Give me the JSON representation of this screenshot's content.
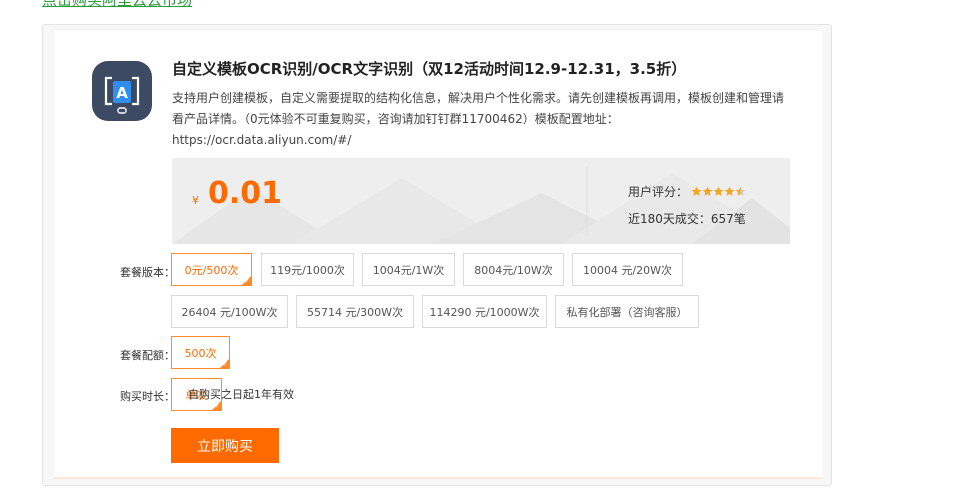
{
  "top_link": "点击购买阿里云云市场",
  "product": {
    "title": "自定义模板OCR识别/OCR文字识别（双12活动时间12.9-12.31，3.5折）",
    "description": "支持用户创建模板，自定义需要提取的结构化信息，解决用户个性化需求。请先创建模板再调用，模板创建和管理请看产品详情。（0元体验不可重复购买，咨询请加钉钉群11700462）模板配置地址：https://ocr.data.aliyun.com/#/",
    "logo_icon": "ocr-scan-logo"
  },
  "pricing": {
    "currency": "¥",
    "price": "0.01",
    "rating_label": "用户评分：",
    "rating": 4.5,
    "rating_max": 5,
    "sales_text": "近180天成交：657笔"
  },
  "colors": {
    "accent": "#ff6a00",
    "star": "#f5a623"
  },
  "package_version": {
    "label": "套餐版本：",
    "options": [
      "0元/500次",
      "119元/1000次",
      "1004元/1W次",
      "8004元/10W次",
      "10004 元/20W次",
      "26404 元/100W次",
      "55714 元/300W次",
      "114290 元/1000W次",
      "私有化部署（咨询客服）"
    ],
    "selected_index": 0
  },
  "package_quota": {
    "label": "套餐配额：",
    "options": [
      "500次"
    ],
    "selected_index": 0
  },
  "duration": {
    "label": "购买时长：",
    "options": [
      "单次"
    ],
    "selected_index": 0,
    "validity_note": "自购买之日起1年有效"
  },
  "buy_button": "立即购买"
}
